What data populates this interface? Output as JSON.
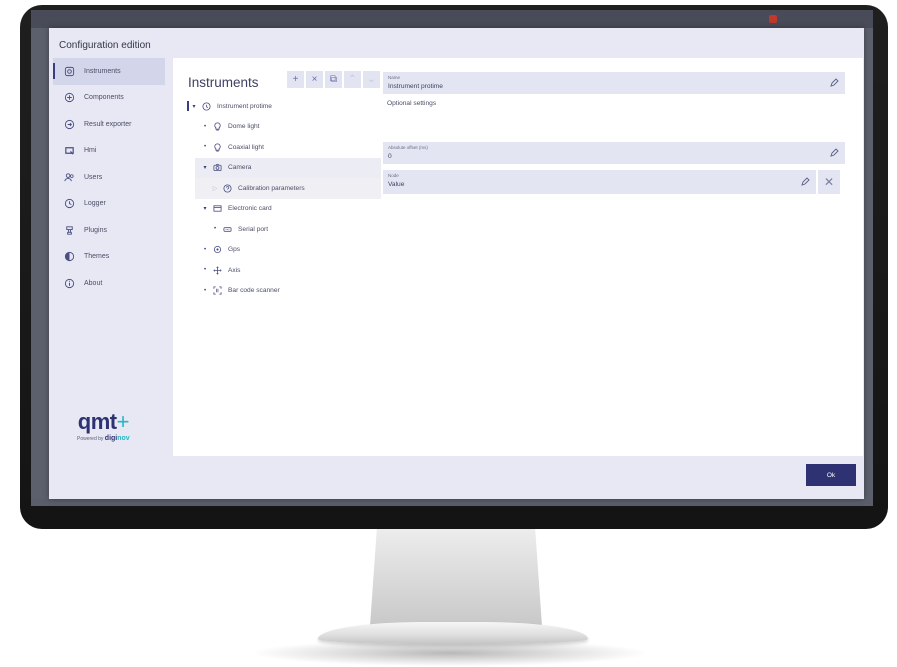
{
  "window": {
    "background_app_title": "",
    "title": "Configuration edition"
  },
  "sidebar": {
    "items": [
      {
        "label": "Instruments",
        "icon": "instruments-icon",
        "active": true
      },
      {
        "label": "Components",
        "icon": "components-icon",
        "active": false
      },
      {
        "label": "Result exporter",
        "icon": "export-icon",
        "active": false
      },
      {
        "label": "Hmi",
        "icon": "hmi-icon",
        "active": false
      },
      {
        "label": "Users",
        "icon": "users-icon",
        "active": false
      },
      {
        "label": "Logger",
        "icon": "logger-icon",
        "active": false
      },
      {
        "label": "Plugins",
        "icon": "plugins-icon",
        "active": false
      },
      {
        "label": "Themes",
        "icon": "themes-icon",
        "active": false
      },
      {
        "label": "About",
        "icon": "info-icon",
        "active": false
      }
    ]
  },
  "logo": {
    "main": "qmt",
    "plus": "+",
    "powered_by": "Powered by",
    "brand_a": "digi",
    "brand_b": "nov"
  },
  "panel": {
    "title": "Instruments",
    "toolbar": {
      "add": "+",
      "remove": "×",
      "copy": "⧉",
      "up": "⌃",
      "down": "⌄"
    }
  },
  "tree": [
    {
      "label": "Instrument protime",
      "icon": "instrument-icon",
      "marker": "▾"
    },
    {
      "label": "Dome light",
      "icon": "bulb-icon",
      "marker": "•"
    },
    {
      "label": "Coaxial light",
      "icon": "bulb-icon",
      "marker": "•"
    },
    {
      "label": "Camera",
      "icon": "camera-icon",
      "marker": "▾"
    },
    {
      "label": "Calibration parameters",
      "icon": "calibration-icon",
      "marker": "▷"
    },
    {
      "label": "Electronic card",
      "icon": "card-icon",
      "marker": "▾"
    },
    {
      "label": "Serial port",
      "icon": "serial-port-icon",
      "marker": "•"
    },
    {
      "label": "Gps",
      "icon": "gps-icon",
      "marker": "•"
    },
    {
      "label": "Axis",
      "icon": "axis-icon",
      "marker": "•"
    },
    {
      "label": "Bar code scanner",
      "icon": "barcode-icon",
      "marker": "•"
    }
  ],
  "properties": {
    "name": {
      "label": "Name",
      "value": "Instrument protime"
    },
    "optional_title": "Optional settings",
    "absolute_offset": {
      "label": "Absolute offset (ms)",
      "value": "0"
    },
    "node": {
      "label": "Node",
      "value": "Value"
    }
  },
  "footer": {
    "ok_label": "Ok"
  },
  "colors": {
    "accent": "#2f3272",
    "teal": "#27b6c4",
    "dialog_bg": "#e7e8f4",
    "field_bg": "#e4e5f3"
  }
}
